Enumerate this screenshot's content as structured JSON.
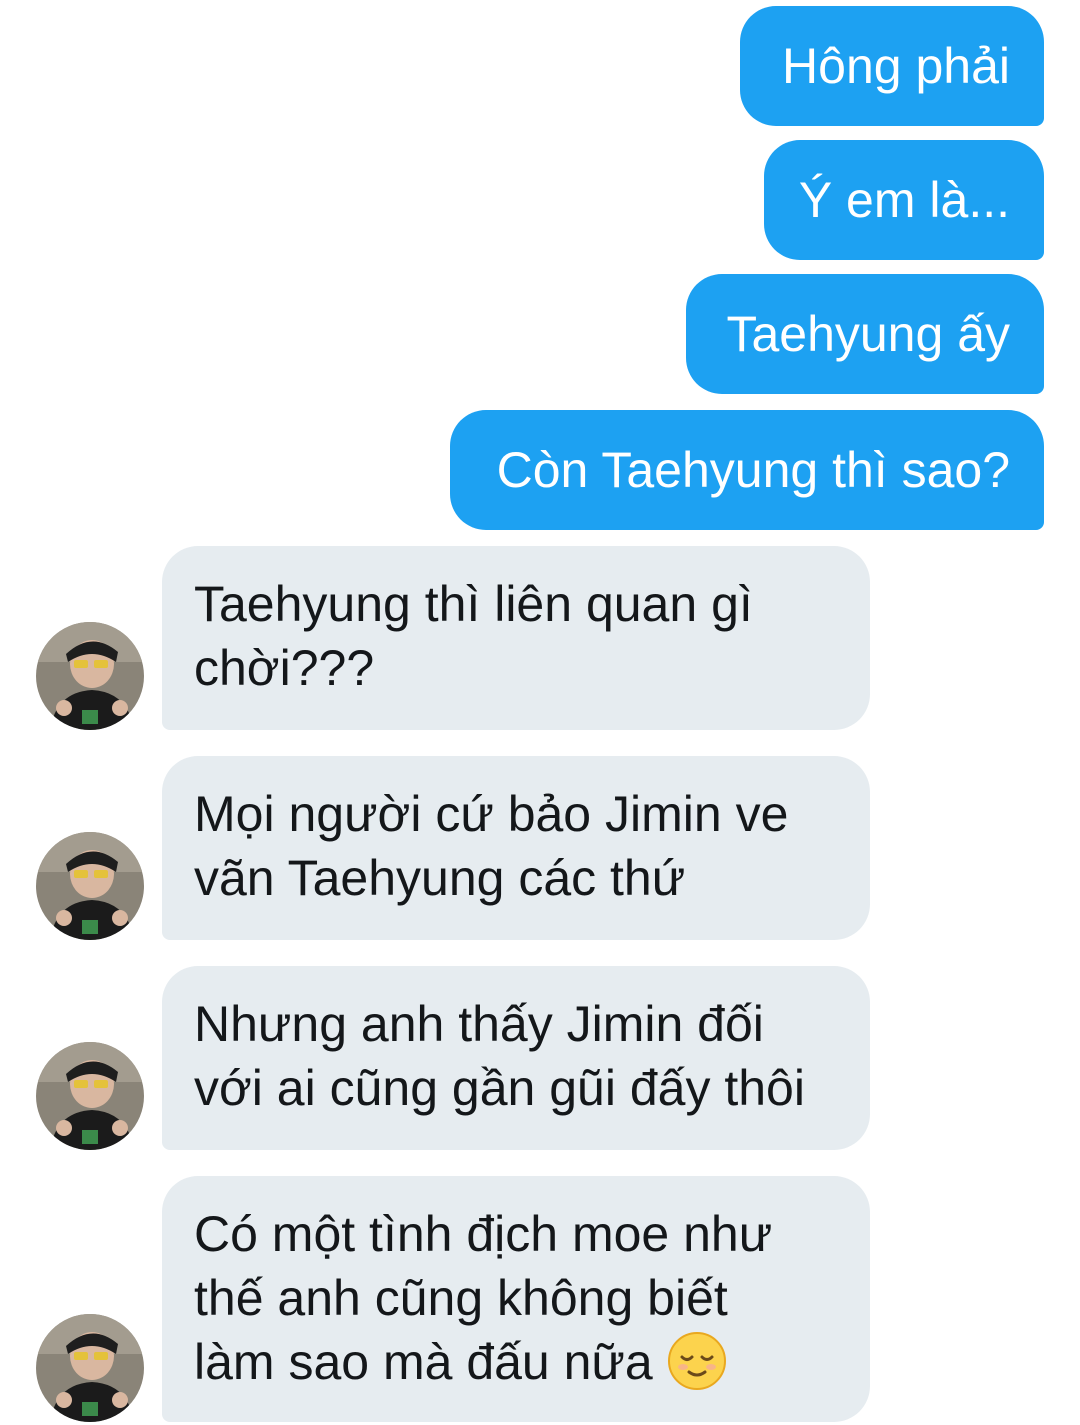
{
  "sent_messages": [
    {
      "text": "Hông phải"
    },
    {
      "text": "Ý em là..."
    },
    {
      "text": "Taehyung ấy"
    },
    {
      "text": "Còn Taehyung thì sao?"
    }
  ],
  "received_messages": [
    {
      "lines": [
        "Taehyung thì liên quan gì",
        "chời???"
      ]
    },
    {
      "lines": [
        "Mọi người cứ bảo Jimin ve",
        "vãn Taehyung các thứ"
      ]
    },
    {
      "lines": [
        "Nhưng anh thấy Jimin đối",
        "với ai cũng gần gũi đấy thôi"
      ]
    },
    {
      "lines": [
        "Có một tình địch moe như",
        "thế anh cũng không biết",
        "làm sao mà đấu nữa"
      ],
      "emoji": "relieved-face-emoji"
    }
  ],
  "colors": {
    "sent_bubble": "#1da1f2",
    "received_bubble": "#e6ecf0",
    "received_text": "#14171a",
    "sent_text": "#ffffff"
  },
  "icons": {
    "avatar": "contact-avatar",
    "emoji": "relieved-face-emoji"
  }
}
